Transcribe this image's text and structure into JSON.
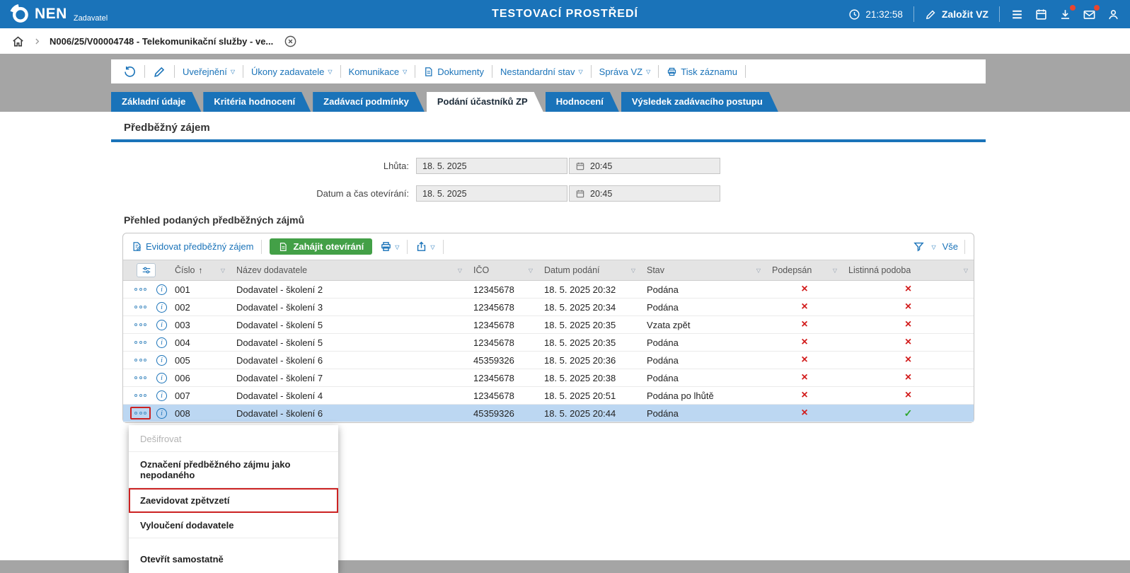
{
  "topbar": {
    "logo_text": "NEN",
    "logo_subtitle": "Zadavatel",
    "environment_title": "TESTOVACÍ PROSTŘEDÍ",
    "clock_time": "21:32:58",
    "create_vz_label": "Založit VZ",
    "icons": [
      "clock-icon",
      "edit-icon",
      "hamburger-menu-icon",
      "calendar-icon",
      "download-icon",
      "mail-icon",
      "user-icon"
    ],
    "notification_badges": [
      "download",
      "mail"
    ]
  },
  "breadcrumb": {
    "record_title": "N006/25/V00004748 - Telekomunikační služby - ve..."
  },
  "record_toolbar": {
    "icons": [
      "history-icon",
      "pencil-icon"
    ],
    "items": [
      {
        "label": "Uveřejnění",
        "caret": true
      },
      {
        "label": "Úkony zadavatele",
        "caret": true
      },
      {
        "label": "Komunikace",
        "caret": true
      },
      {
        "label": "Dokumenty",
        "icon": "doc"
      },
      {
        "label": "Nestandardní stav",
        "caret": true
      },
      {
        "label": "Správa VZ",
        "caret": true
      },
      {
        "label": "Tisk záznamu",
        "icon": "printer"
      }
    ]
  },
  "tabs": [
    {
      "label": "Základní údaje",
      "active": false
    },
    {
      "label": "Kritéria hodnocení",
      "active": false
    },
    {
      "label": "Zadávací podmínky",
      "active": false
    },
    {
      "label": "Podání účastníků ZP",
      "active": true
    },
    {
      "label": "Hodnocení",
      "active": false
    },
    {
      "label": "Výsledek zadávacího postupu",
      "active": false
    }
  ],
  "section": {
    "title": "Předběžný zájem",
    "fields": [
      {
        "label": "Lhůta:",
        "date": "18. 5. 2025",
        "time": "20:45"
      },
      {
        "label": "Datum a čas otevírání:",
        "date": "18. 5. 2025",
        "time": "20:45"
      }
    ],
    "table_heading": "Přehled podaných předběžných zájmů"
  },
  "table": {
    "toolbar": {
      "register_label": "Evidovat předběžný zájem",
      "open_label": "Zahájit otevírání",
      "filter_all_label": "Vše",
      "icons": [
        "printer-icon",
        "export-icon",
        "filter-icon"
      ]
    },
    "columns": [
      {
        "label": "Číslo",
        "sorted": true
      },
      {
        "label": "Název dodavatele"
      },
      {
        "label": "IČO"
      },
      {
        "label": "Datum podání"
      },
      {
        "label": "Stav"
      },
      {
        "label": "Podepsán"
      },
      {
        "label": "Listinná podoba"
      }
    ],
    "rows": [
      {
        "cislo": "001",
        "nazev": "Dodavatel - školení 2",
        "ico": "12345678",
        "datum": "18. 5. 2025 20:32",
        "stav": "Podána",
        "podepsan": "cross",
        "listinna": "cross",
        "selected": false,
        "menu_open": false
      },
      {
        "cislo": "002",
        "nazev": "Dodavatel - školení 3",
        "ico": "12345678",
        "datum": "18. 5. 2025 20:34",
        "stav": "Podána",
        "podepsan": "cross",
        "listinna": "cross",
        "selected": false,
        "menu_open": false
      },
      {
        "cislo": "003",
        "nazev": "Dodavatel - školení 5",
        "ico": "12345678",
        "datum": "18. 5. 2025 20:35",
        "stav": "Vzata zpět",
        "podepsan": "cross",
        "listinna": "cross",
        "selected": false,
        "menu_open": false
      },
      {
        "cislo": "004",
        "nazev": "Dodavatel - školení 5",
        "ico": "12345678",
        "datum": "18. 5. 2025 20:35",
        "stav": "Podána",
        "podepsan": "cross",
        "listinna": "cross",
        "selected": false,
        "menu_open": false
      },
      {
        "cislo": "005",
        "nazev": "Dodavatel - školení 6",
        "ico": "45359326",
        "datum": "18. 5. 2025 20:36",
        "stav": "Podána",
        "podepsan": "cross",
        "listinna": "cross",
        "selected": false,
        "menu_open": false
      },
      {
        "cislo": "006",
        "nazev": "Dodavatel - školení 7",
        "ico": "12345678",
        "datum": "18. 5. 2025 20:38",
        "stav": "Podána",
        "podepsan": "cross",
        "listinna": "cross",
        "selected": false,
        "menu_open": false
      },
      {
        "cislo": "007",
        "nazev": "Dodavatel - školení 4",
        "ico": "12345678",
        "datum": "18. 5. 2025 20:51",
        "stav": "Podána po lhůtě",
        "podepsan": "cross",
        "listinna": "cross",
        "selected": false,
        "menu_open": false
      },
      {
        "cislo": "008",
        "nazev": "Dodavatel - školení 6",
        "ico": "45359326",
        "datum": "18. 5. 2025 20:44",
        "stav": "Podána",
        "podepsan": "cross",
        "listinna": "check",
        "selected": true,
        "menu_open": true
      }
    ]
  },
  "context_menu": {
    "items": [
      {
        "label": "Dešifrovat",
        "disabled": true
      },
      {
        "label": "Označení předběžného zájmu jako nepodaného"
      },
      {
        "label": "Zaevidovat zpětvzetí",
        "highlighted": true
      },
      {
        "label": "Vyloučení dodavatele"
      },
      {
        "label": "Otevřít samostatně",
        "separated": true
      }
    ]
  },
  "colors": {
    "brand_blue": "#1a73b9",
    "green_button": "#43a047",
    "selected_row": "#bcd7f2",
    "cross_red": "#d21c1c",
    "check_green": "#2ea62e",
    "highlight_red": "#cc2222",
    "page_background": "#a5a5a5"
  }
}
